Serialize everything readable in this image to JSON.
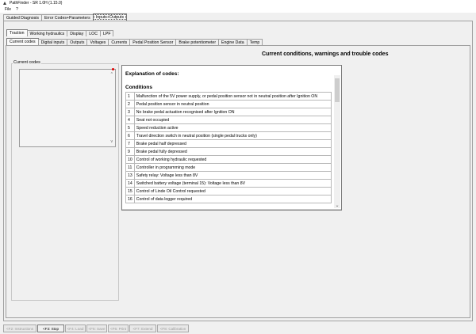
{
  "window": {
    "title": "PathFinder - SR 1.0H (1.15.0)",
    "menu_file": "File",
    "menu_help": "?"
  },
  "main_tabs": [
    {
      "label": "Guided Diagnosis"
    },
    {
      "label": "Error Codes+Parameters"
    },
    {
      "label": "Inputs+Outputs"
    }
  ],
  "category_tabs": [
    {
      "label": "Traction"
    },
    {
      "label": "Working hydraulics"
    },
    {
      "label": "Display"
    },
    {
      "label": "LOC"
    },
    {
      "label": "LPF"
    }
  ],
  "sub_tabs": [
    {
      "label": "Current codes"
    },
    {
      "label": "Digital inputs"
    },
    {
      "label": "Outputs"
    },
    {
      "label": "Voltages"
    },
    {
      "label": "Currents"
    },
    {
      "label": "Pedal Position Sensor"
    },
    {
      "label": "Brake potentiometer"
    },
    {
      "label": "Engine Data"
    },
    {
      "label": "Temp"
    }
  ],
  "heading": "Current conditions, warnings and trouble codes",
  "current_codes": {
    "label": "Current codes",
    "scroll_up": "^",
    "scroll_down": "v"
  },
  "explanation": {
    "title": "Explanation of codes:",
    "subtitle": "Conditions",
    "scroll_down": "⌄",
    "rows": [
      {
        "num": "1",
        "text": "Malfunction of the 5V power supply, or pedal position sensor not in neutral position after Ignition ON"
      },
      {
        "num": "2",
        "text": "Pedal position sensor in neutral position"
      },
      {
        "num": "3",
        "text": "No brake pedal actuation recognised after Ignition ON"
      },
      {
        "num": "4",
        "text": "Seat not occupied"
      },
      {
        "num": "5",
        "text": "Speed reduction active"
      },
      {
        "num": "6",
        "text": "Travel direction switch in neutral position (single pedal trucks only)"
      },
      {
        "num": "7",
        "text": "Brake pedal half depressed"
      },
      {
        "num": "9",
        "text": "Brake pedal fully depressed"
      },
      {
        "num": "10",
        "text": "Control of working hydraulic requested"
      },
      {
        "num": "11",
        "text": "Controller in programming mode"
      },
      {
        "num": "13",
        "text": "Safety relay: Voltage less than 8V"
      },
      {
        "num": "14",
        "text": "Switched battery voltage (terminal 15): Voltage less than 8V"
      },
      {
        "num": "15",
        "text": "Control of Linde Oil Control requested"
      },
      {
        "num": "16",
        "text": "Control of data logger required"
      }
    ]
  },
  "function_keys": [
    {
      "label": "<F2: Instructions",
      "enabled": false
    },
    {
      "label": "<F3: Stop",
      "enabled": true
    },
    {
      "label": "<F4: Load",
      "enabled": false
    },
    {
      "label": "<F5: Save",
      "enabled": false
    },
    {
      "label": "<F6: Print",
      "enabled": false
    },
    {
      "label": "<F7: Extend",
      "enabled": false
    },
    {
      "label": "<F8: Calibration",
      "enabled": false
    }
  ],
  "colors": {
    "accent_dot": "#e00000",
    "panel_bg": "#f0f0f0",
    "border": "#a0a0a0"
  }
}
